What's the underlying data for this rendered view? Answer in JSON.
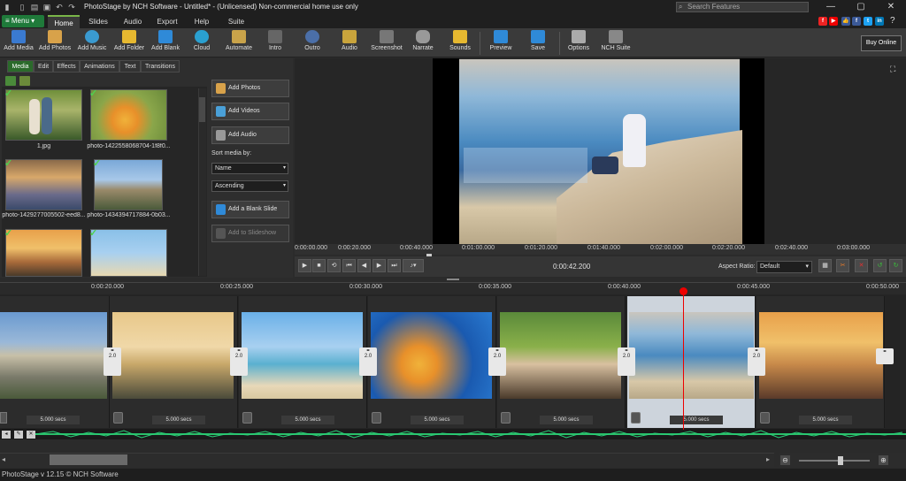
{
  "titlebar": {
    "title": "PhotoStage by NCH Software - Untitled* - (Unlicensed) Non-commercial home use only",
    "search_placeholder": "Search Features"
  },
  "menu": {
    "menu_label": "Menu",
    "tabs": [
      "Home",
      "Slides",
      "Audio",
      "Export",
      "Help",
      "Suite"
    ]
  },
  "ribbon": {
    "buttons": [
      "Add Media",
      "Add Photos",
      "Add Music",
      "Add Folder",
      "Add Blank",
      "Cloud",
      "Automate",
      "Intro",
      "Outro",
      "Audio",
      "Screenshot",
      "Narrate",
      "Sounds",
      "Preview",
      "Save",
      "Options",
      "NCH Suite"
    ],
    "buy_label": "Buy Online"
  },
  "panel": {
    "tabs": [
      "Media",
      "Edit",
      "Effects",
      "Animations",
      "Text",
      "Transitions"
    ],
    "media": [
      {
        "label": "1.jpg"
      },
      {
        "label": "photo-1422558068704-1f8f0..."
      },
      {
        "label": "photo-1429277005502-eed8..."
      },
      {
        "label": "photo-1434394717884-0b03..."
      },
      {
        "label": ""
      },
      {
        "label": ""
      }
    ],
    "add_photos": "Add Photos",
    "add_videos": "Add Videos",
    "add_audio": "Add Audio",
    "sort_label": "Sort media by:",
    "sort_field": "Name",
    "sort_order": "Ascending",
    "add_blank": "Add a Blank Slide",
    "add_to_slideshow": "Add to Slideshow"
  },
  "preview": {
    "ruler": [
      "0:00:00.000",
      "0:00:20.000",
      "0:00:40.000",
      "0:01:00.000",
      "0:01:20.000",
      "0:01:40.000",
      "0:02:00.000",
      "0:02:20.000",
      "0:02:40.000",
      "0:03:00.000"
    ],
    "time": "0:00:42.200",
    "aspect_label": "Aspect Ratio:",
    "aspect_value": "Default"
  },
  "timeline": {
    "ruler": [
      "0:00:20.000",
      "0:00:25.000",
      "0:00:30.000",
      "0:00:35.000",
      "0:00:40.000",
      "0:00:45.000",
      "0:00:50.000"
    ],
    "clips": [
      {
        "duration": "5.000 secs",
        "transition": "2.0"
      },
      {
        "duration": "5.000 secs",
        "transition": "2.0"
      },
      {
        "duration": "5.000 secs",
        "transition": "2.0"
      },
      {
        "duration": "5.000 secs",
        "transition": "2.0"
      },
      {
        "duration": "5.000 secs",
        "transition": "2.0"
      },
      {
        "duration": "5.000 secs",
        "transition": "2.0"
      },
      {
        "duration": "5.000 secs",
        "transition": ""
      }
    ]
  },
  "status": {
    "text": "PhotoStage v 12.15 © NCH Software"
  }
}
